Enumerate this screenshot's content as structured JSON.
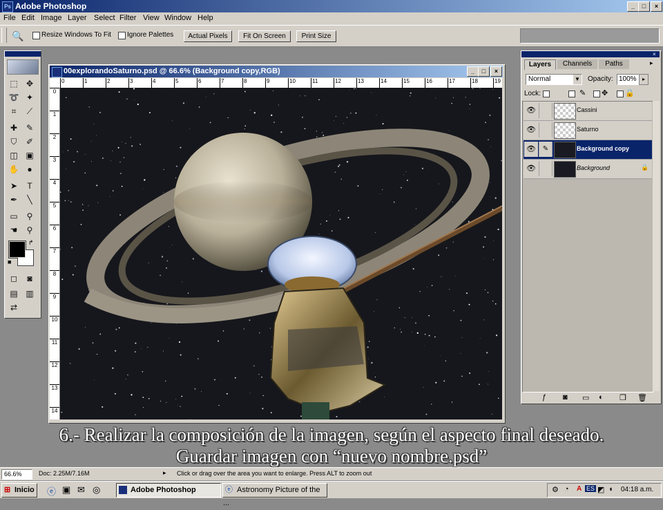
{
  "app": {
    "title": "Adobe Photoshop"
  },
  "menu": [
    "File",
    "Edit",
    "Image",
    "Layer",
    "Select",
    "Filter",
    "View",
    "Window",
    "Help"
  ],
  "options": {
    "resize_label": "Resize Windows To Fit",
    "ignore_label": "Ignore Palettes",
    "actual_pixels": "Actual Pixels",
    "fit_on_screen": "Fit On Screen",
    "print_size": "Print Size"
  },
  "document": {
    "title": "00explorandoSaturno.psd @ 66.6% (Background copy,RGB)",
    "ruler_ticks": [
      "0",
      "1",
      "2",
      "3",
      "4",
      "5",
      "6",
      "7",
      "8",
      "9",
      "10",
      "11",
      "12",
      "13",
      "14",
      "15",
      "16",
      "17",
      "18",
      "19"
    ],
    "ruler_left_ticks": [
      "0",
      "1",
      "2",
      "3",
      "4",
      "5",
      "6",
      "7",
      "8",
      "9",
      "10",
      "11",
      "12",
      "13",
      "14"
    ]
  },
  "layers_palette": {
    "tabs": [
      "Layers",
      "Channels",
      "Paths"
    ],
    "blend_mode": "Normal",
    "opacity_label": "Opacity:",
    "opacity_value": "100%",
    "lock_label": "Lock:",
    "layers": [
      {
        "name": "Cassini",
        "active": false
      },
      {
        "name": "Saturno",
        "active": false
      },
      {
        "name": "Background copy",
        "active": true
      },
      {
        "name": "Background",
        "active": false
      }
    ]
  },
  "status": {
    "zoom": "66.6%",
    "doc": "Doc: 2.25M/7.16M",
    "hint": "Click or drag over the area you want to enlarge. Press ALT to zoom out"
  },
  "caption": {
    "line1": "6.- Realizar la composición de la imagen, según el aspecto final deseado.",
    "line2": "Guardar imagen con “nuevo nombre.psd”"
  },
  "taskbar": {
    "start": "Inicio",
    "task1": "Adobe Photoshop",
    "task2": "Astronomy Picture of the ...",
    "lang": "ES",
    "clock": "04:18 a.m."
  }
}
